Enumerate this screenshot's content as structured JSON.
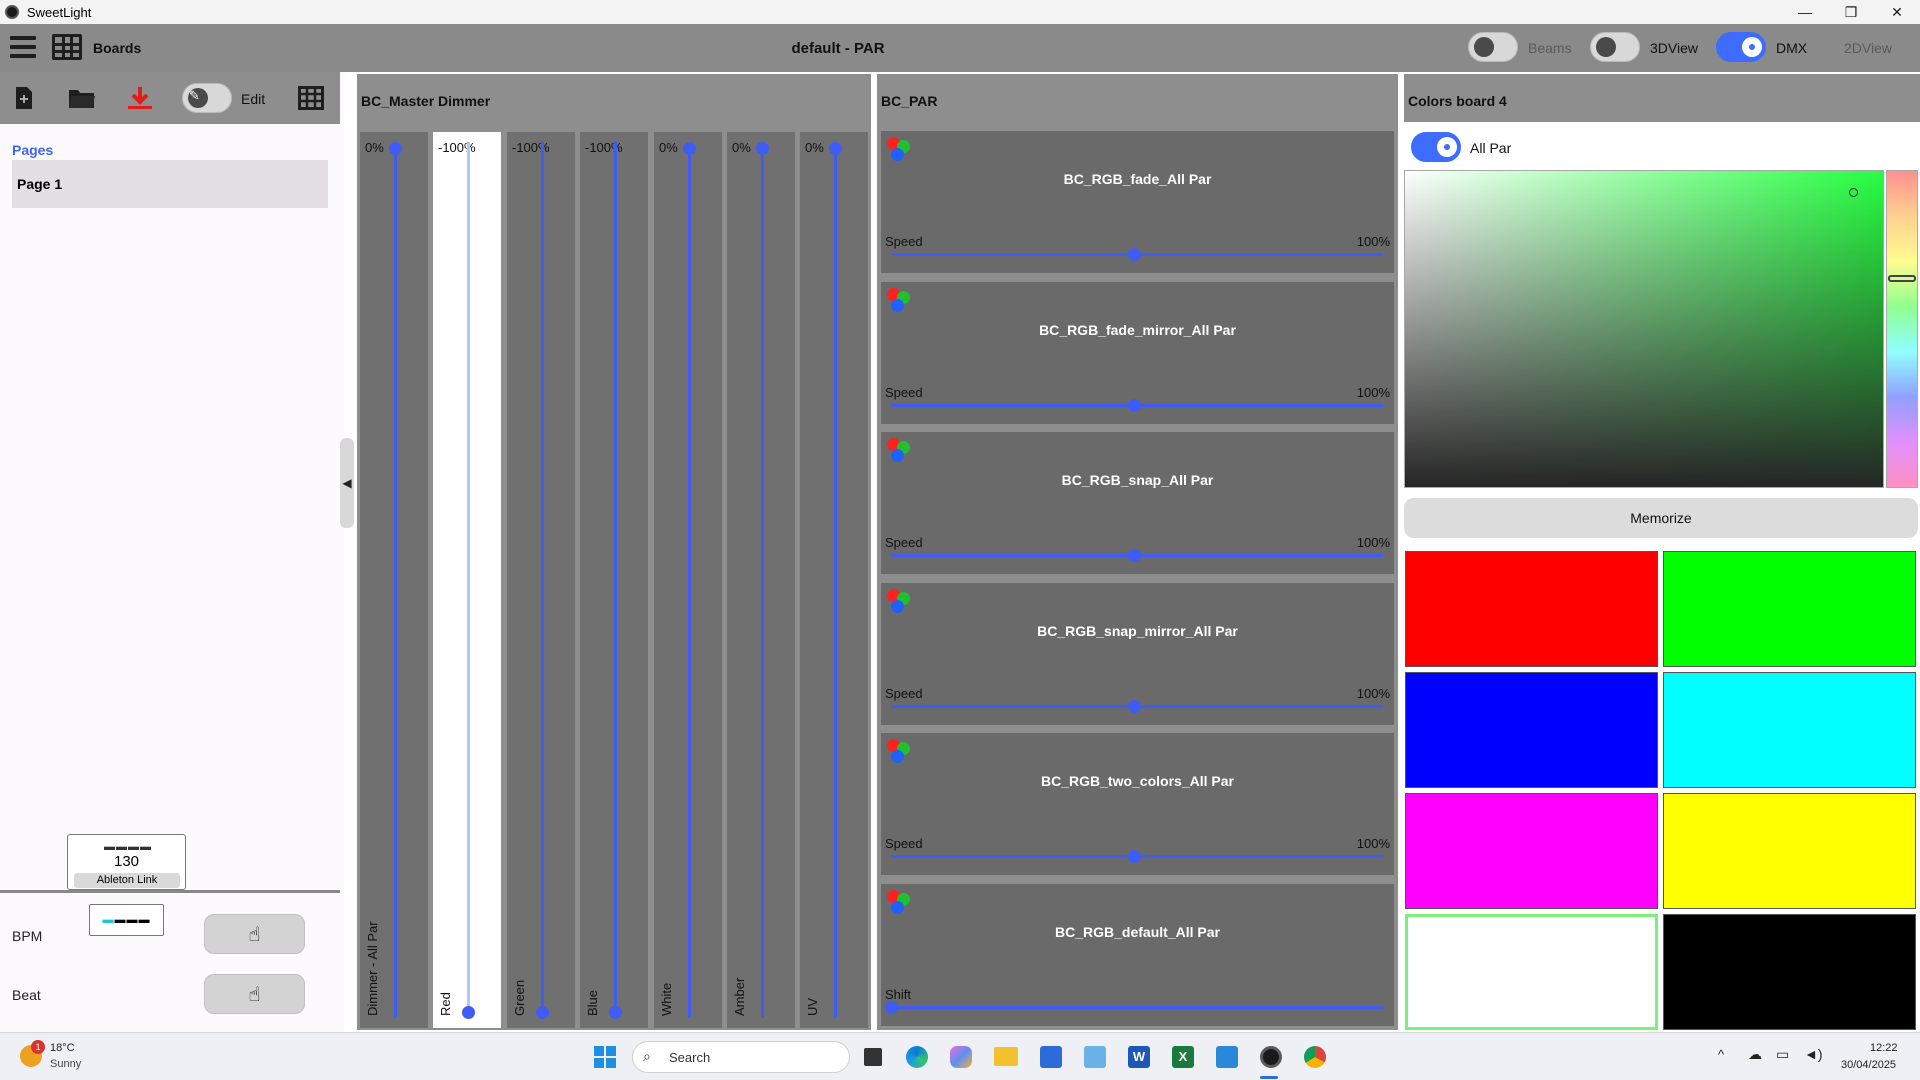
{
  "window": {
    "app_name": "SweetLight",
    "minimize": "—",
    "restore": "❐",
    "close": "✕"
  },
  "header": {
    "boards_label": "Boards",
    "title": "default - PAR",
    "beams_label": "Beams",
    "view3d_label": "3DView",
    "dmx_label": "DMX",
    "view2d_label": "2DView",
    "beams_on": false,
    "view3d_on": false,
    "dmx_on": true
  },
  "left": {
    "edit_label": "Edit",
    "pages_title": "Pages",
    "page1": "Page 1",
    "collapse_glyph": "◀",
    "bpm_label": "BPM",
    "bpm_value": "130",
    "bpm_dashes": "▬▬▬▬",
    "ableton": "Ableton Link",
    "beat_label": "Beat",
    "beat_dash_active": "▬",
    "beat_dashes": "▬▬▬",
    "tap_glyph": "☝"
  },
  "dimmer": {
    "title": "BC_Master Dimmer",
    "faders": [
      {
        "value": "0%",
        "label": "Dimmer - All Par",
        "level": 1.0,
        "white": false
      },
      {
        "value": "-100%",
        "label": "Red",
        "level": 0.0,
        "white": true
      },
      {
        "value": "-100%",
        "label": "Green",
        "level": 0.0,
        "white": false
      },
      {
        "value": "-100%",
        "label": "Blue",
        "level": 0.0,
        "white": false
      },
      {
        "value": "0%",
        "label": "White",
        "level": 1.0,
        "white": false
      },
      {
        "value": "0%",
        "label": "Amber",
        "level": 1.0,
        "white": false
      },
      {
        "value": "0%",
        "label": "UV",
        "level": 1.0,
        "white": false
      }
    ]
  },
  "par": {
    "title": "BC_PAR",
    "tiles": [
      {
        "name": "BC_RGB_fade_All Par",
        "param": "Speed",
        "value": "100%",
        "level": 0.5
      },
      {
        "name": "BC_RGB_fade_mirror_All Par",
        "param": "Speed",
        "value": "100%",
        "level": 0.5
      },
      {
        "name": "BC_RGB_snap_All Par",
        "param": "Speed",
        "value": "100%",
        "level": 0.5
      },
      {
        "name": "BC_RGB_snap_mirror_All Par",
        "param": "Speed",
        "value": "100%",
        "level": 0.5
      },
      {
        "name": "BC_RGB_two_colors_All Par",
        "param": "Speed",
        "value": "100%",
        "level": 0.5
      },
      {
        "name": "BC_RGB_default_All Par",
        "param": "Shift",
        "value": "",
        "level": 0.0
      }
    ]
  },
  "colors": {
    "title": "Colors board 4",
    "all_par_label": "All Par",
    "all_par_on": true,
    "memorize_label": "Memorize",
    "swatches": [
      "#ff0000",
      "#00ff00",
      "#0000ff",
      "#00ffff",
      "#ff00ff",
      "#ffff00",
      "#ffffff",
      "#000000"
    ]
  },
  "taskbar": {
    "temp": "18°C",
    "weather": "Sunny",
    "weather_badge": "1",
    "search_placeholder": "Search",
    "time": "12:22",
    "date": "30/04/2025"
  }
}
